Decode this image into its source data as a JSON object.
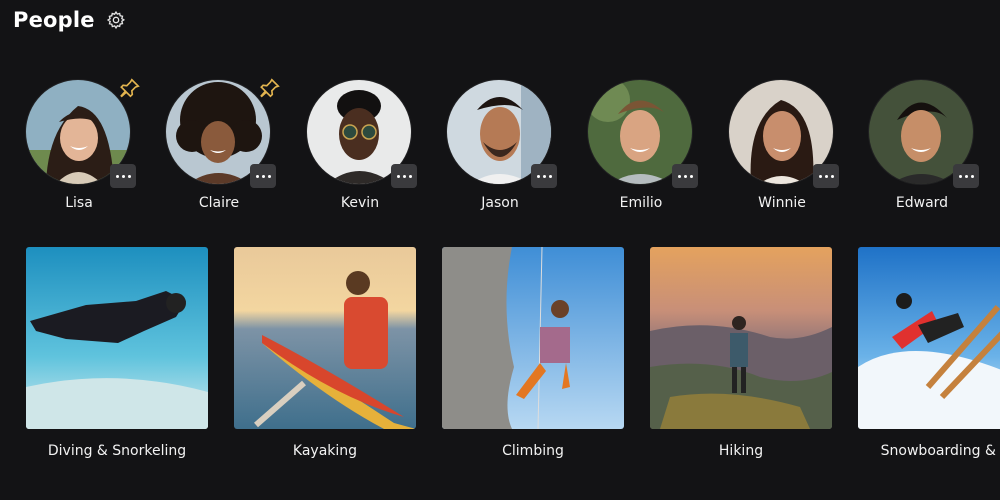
{
  "header": {
    "title": "People",
    "settings_icon": "gear-icon"
  },
  "people": [
    {
      "name": "Lisa",
      "pinned": true,
      "more_icon": "more-icon"
    },
    {
      "name": "Claire",
      "pinned": true,
      "more_icon": "more-icon"
    },
    {
      "name": "Kevin",
      "pinned": false,
      "more_icon": "more-icon"
    },
    {
      "name": "Jason",
      "pinned": false,
      "more_icon": "more-icon"
    },
    {
      "name": "Emilio",
      "pinned": false,
      "more_icon": "more-icon"
    },
    {
      "name": "Winnie",
      "pinned": false,
      "more_icon": "more-icon"
    },
    {
      "name": "Edward",
      "pinned": false,
      "more_icon": "more-icon"
    }
  ],
  "activities": [
    {
      "label": "Diving & Snorkeling"
    },
    {
      "label": "Kayaking"
    },
    {
      "label": "Climbing"
    },
    {
      "label": "Hiking"
    },
    {
      "label": "Snowboarding & Sk"
    }
  ],
  "colors": {
    "background": "#131315",
    "text": "#ffffff",
    "pin": "#e2b44f",
    "more_button": "#3a3a3d"
  }
}
